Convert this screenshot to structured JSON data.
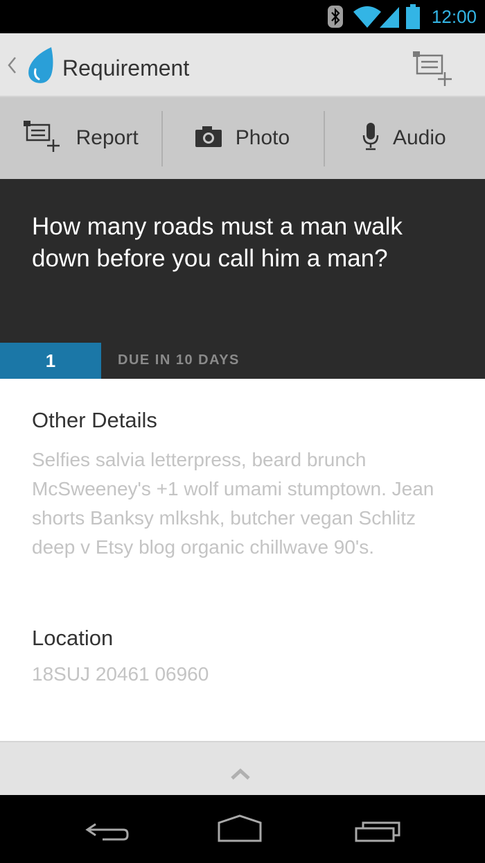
{
  "status_bar": {
    "time": "12:00",
    "icons": [
      "bluetooth-icon",
      "wifi-icon",
      "signal-icon",
      "battery-icon"
    ],
    "accent_color": "#33b5e5"
  },
  "action_bar": {
    "title": "Requirement",
    "back_icon": "chevron-left-icon",
    "logo_icon": "water-drop-logo",
    "action_icon": "add-report-icon"
  },
  "toolbar": {
    "buttons": [
      {
        "label": "Report",
        "icon": "add-report-icon"
      },
      {
        "label": "Photo",
        "icon": "camera-icon"
      },
      {
        "label": "Audio",
        "icon": "microphone-icon"
      }
    ]
  },
  "question": {
    "text": "How many roads must a man walk down before you call him a man?",
    "count": "1",
    "due": "DUE IN 10 DAYS",
    "badge_color": "#1b77a7"
  },
  "details": {
    "title": "Other Details",
    "body": "Selfies salvia letterpress, beard brunch McSweeney's +1 wolf umami stumptown. Jean shorts Banksy mlkshk, butcher vegan Schlitz deep v Etsy blog organic chillwave 90's."
  },
  "location": {
    "title": "Location",
    "value": "18SUJ 20461 06960"
  },
  "drawer": {
    "icon": "chevron-up-icon"
  },
  "nav": {
    "buttons": [
      "back-icon",
      "home-icon",
      "recent-apps-icon"
    ]
  }
}
